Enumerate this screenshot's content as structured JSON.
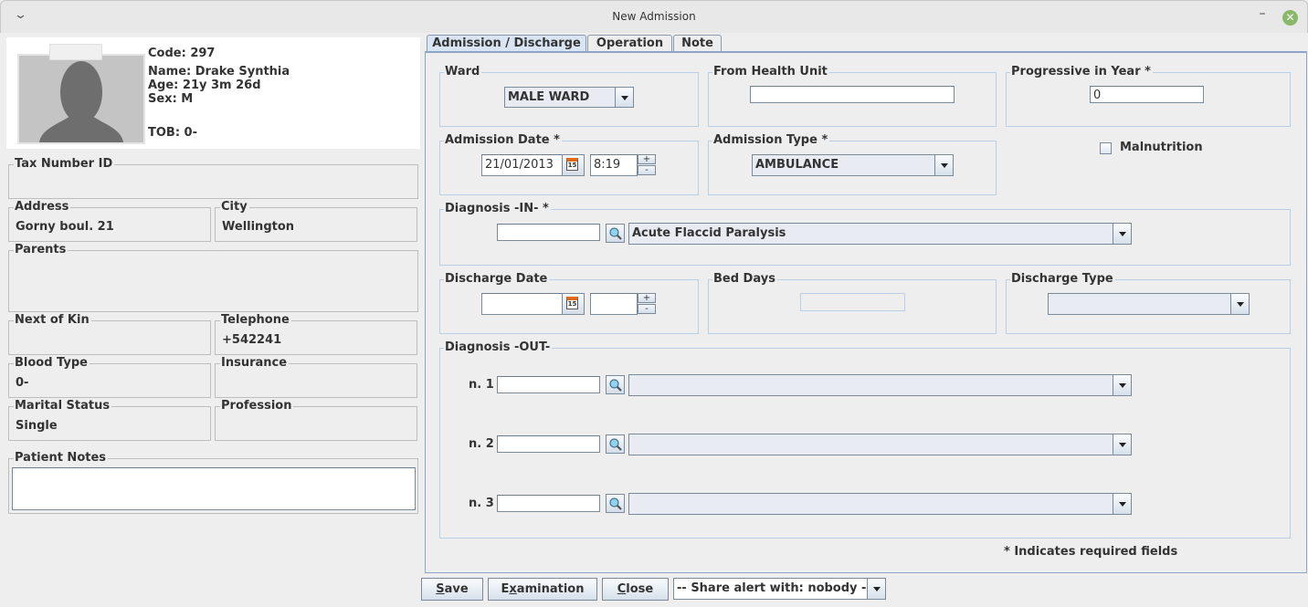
{
  "window": {
    "title": "New Admission",
    "menu_icon": "chevron-down-icon",
    "minimize_glyph": "–",
    "close_glyph": "✕"
  },
  "patient": {
    "code": "Code: 297",
    "name": "Name: Drake Synthia",
    "age": "Age: 21y 3m 26d",
    "sex": "Sex: M",
    "tob": "TOB: 0-"
  },
  "patient_fields": {
    "tax_number": {
      "label": "Tax Number ID",
      "value": ""
    },
    "address": {
      "label": "Address",
      "value": "Gorny boul. 21"
    },
    "city": {
      "label": "City",
      "value": "Wellington"
    },
    "parents": {
      "label": "Parents",
      "value": ""
    },
    "next_of_kin": {
      "label": "Next of Kin",
      "value": ""
    },
    "telephone": {
      "label": "Telephone",
      "value": "+542241"
    },
    "blood_type": {
      "label": "Blood Type",
      "value": "0-"
    },
    "insurance": {
      "label": "Insurance",
      "value": ""
    },
    "marital_status": {
      "label": "Marital Status",
      "value": "Single"
    },
    "profession": {
      "label": "Profession",
      "value": ""
    },
    "patient_notes": {
      "label": "Patient Notes",
      "value": ""
    }
  },
  "tabs": [
    {
      "label": "Admission / Discharge",
      "active": true
    },
    {
      "label": "Operation",
      "active": false
    },
    {
      "label": "Note",
      "active": false
    }
  ],
  "admission": {
    "ward": {
      "label": "Ward",
      "value": "MALE WARD"
    },
    "from_health_unit": {
      "label": "From Health Unit",
      "value": ""
    },
    "progressive_in_year": {
      "label": "Progressive in Year *",
      "value": "0"
    },
    "admission_date": {
      "label": "Admission Date *",
      "date": "21/01/2013",
      "time": "8:19",
      "calendar_day": "15"
    },
    "admission_type": {
      "label": "Admission Type *",
      "value": "AMBULANCE"
    },
    "malnutrition": {
      "label": "Malnutrition",
      "checked": false
    },
    "diagnosis_in": {
      "label": "Diagnosis -IN- *",
      "code": "",
      "value": "Acute Flaccid Paralysis"
    },
    "discharge_date": {
      "label": "Discharge Date",
      "date": "",
      "time": "",
      "calendar_day": "15"
    },
    "bed_days": {
      "label": "Bed Days",
      "value": ""
    },
    "discharge_type": {
      "label": "Discharge Type",
      "value": ""
    },
    "diagnosis_out": {
      "label": "Diagnosis -OUT-",
      "rows": [
        {
          "label": "n. 1",
          "code": "",
          "value": ""
        },
        {
          "label": "n. 2",
          "code": "",
          "value": ""
        },
        {
          "label": "n. 3",
          "code": "",
          "value": ""
        }
      ]
    },
    "required_note": "* Indicates required fields",
    "spinner_up": "+",
    "spinner_down": "-"
  },
  "footer": {
    "save": {
      "mnemonic": "S",
      "rest": "ave"
    },
    "examination": {
      "pre": "E",
      "mnemonic": "x",
      "rest": "amination"
    },
    "close": {
      "mnemonic": "C",
      "rest": "lose"
    },
    "share_alert": "-- Share alert with: nobody --"
  },
  "colors": {
    "accent_blue": "#dae5f3",
    "panel_border": "#8da5c8",
    "calendar_orange": "#e06a1a",
    "window_close_green": "#8ab86a"
  }
}
